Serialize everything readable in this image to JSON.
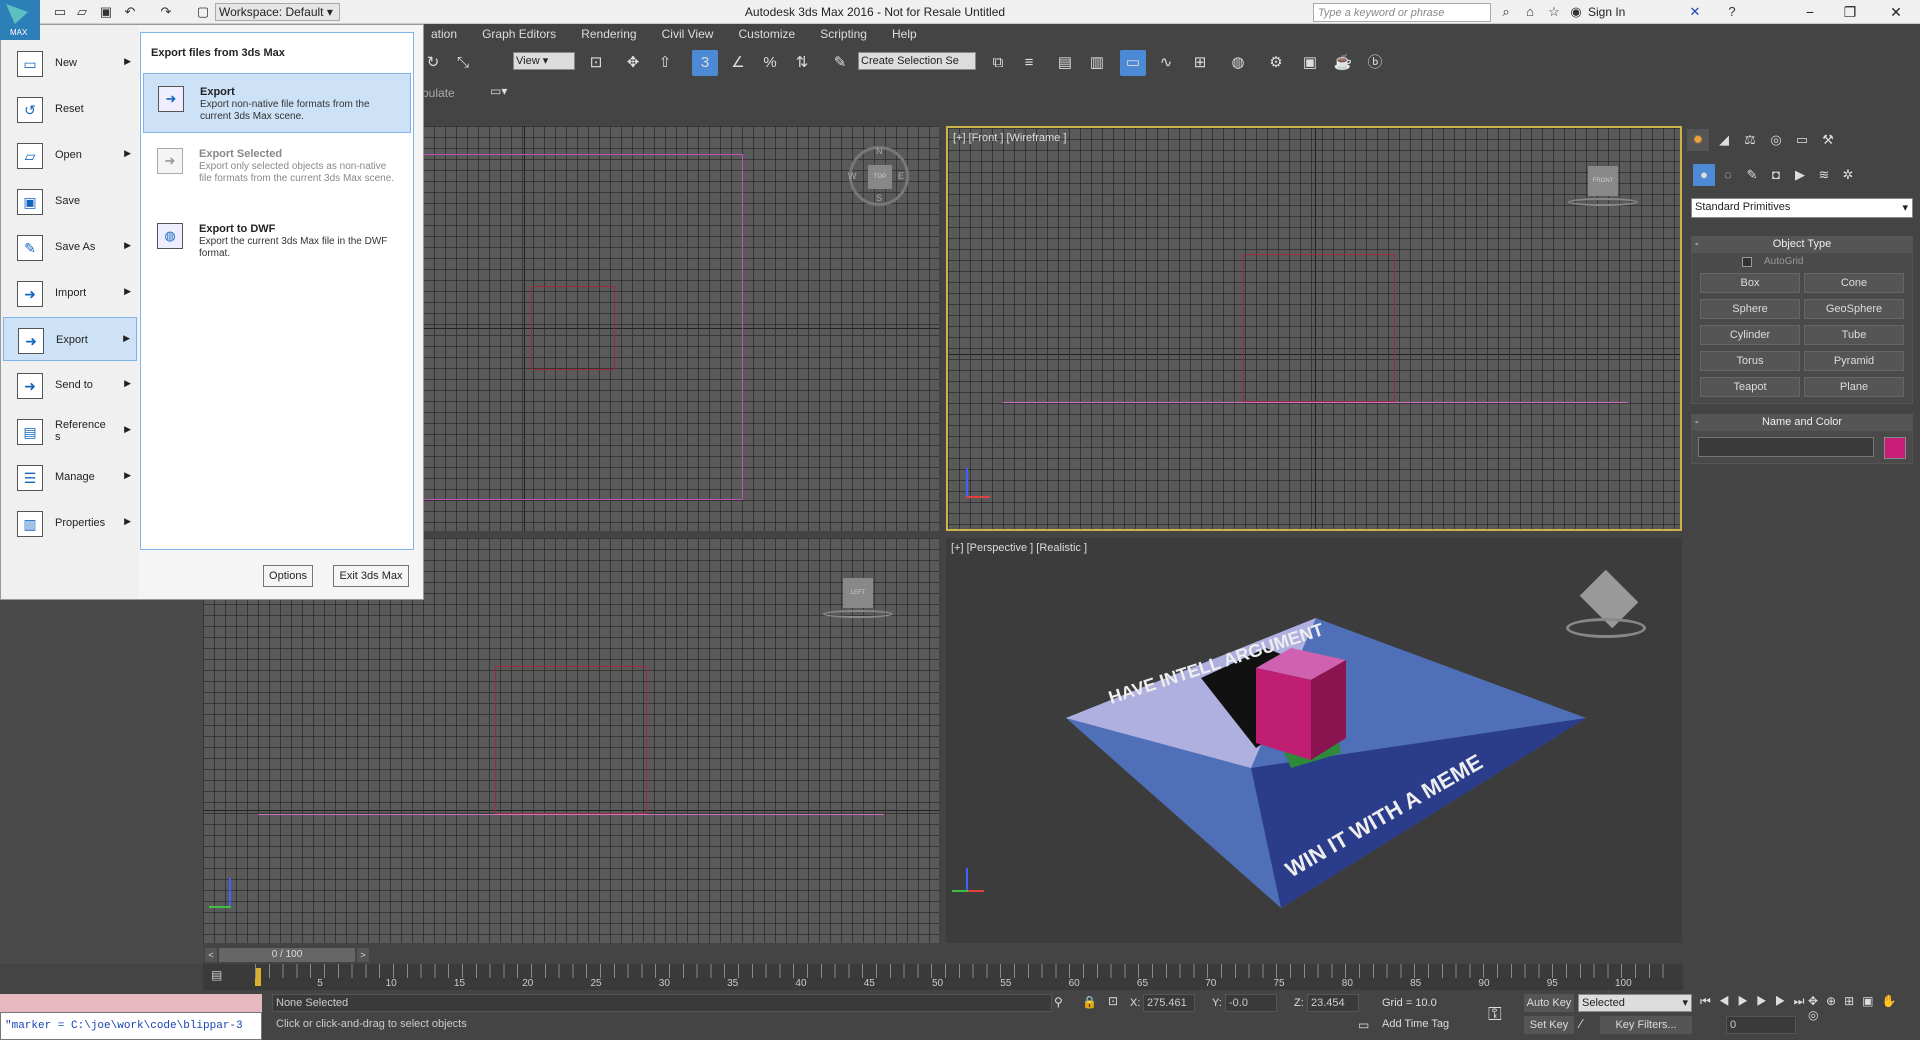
{
  "titlebar": {
    "title": "Autodesk 3ds Max 2016 - Not for Resale    Untitled",
    "workspace": "Workspace: Default",
    "search_placeholder": "Type a keyword or phrase",
    "signin": "Sign In"
  },
  "menubar": {
    "items": [
      "ation",
      "Graph Editors",
      "Rendering",
      "Civil View",
      "Customize",
      "Scripting",
      "Help"
    ]
  },
  "toolbar": {
    "view_dropdown": "View",
    "selection_set": "Create Selection Se",
    "snap_number": "3",
    "ribbon_hint": "pulate"
  },
  "app_menu": {
    "items": [
      {
        "label": "New",
        "icon": "new-icon",
        "arrow": true
      },
      {
        "label": "Reset",
        "icon": "reset-icon",
        "arrow": false
      },
      {
        "label": "Open",
        "icon": "open-icon",
        "arrow": true
      },
      {
        "label": "Save",
        "icon": "save-icon",
        "arrow": false
      },
      {
        "label": "Save As",
        "icon": "save-as-icon",
        "arrow": true
      },
      {
        "label": "Import",
        "icon": "import-icon",
        "arrow": true
      },
      {
        "label": "Export",
        "icon": "export-icon",
        "arrow": true,
        "selected": true
      },
      {
        "label": "Send to",
        "icon": "send-to-icon",
        "arrow": true
      },
      {
        "label": "Reference\ns",
        "icon": "references-icon",
        "arrow": true
      },
      {
        "label": "Manage",
        "icon": "manage-icon",
        "arrow": true
      },
      {
        "label": "Properties",
        "icon": "properties-icon",
        "arrow": true
      }
    ],
    "submenu": {
      "header": "Export files from 3ds Max",
      "items": [
        {
          "title": "Export",
          "desc": "Export non-native file formats from the current 3ds Max scene.",
          "state": "selected"
        },
        {
          "title": "Export Selected",
          "desc": "Export only selected objects as non-native file formats from the current 3ds Max scene.",
          "state": "disabled"
        },
        {
          "title": "Export to DWF",
          "desc": "Export the current 3ds Max file in the DWF format.",
          "state": "normal"
        }
      ]
    },
    "options_label": "Options",
    "exit_label": "Exit 3ds Max",
    "max_label": "MAX"
  },
  "viewports": {
    "front": "[+] [Front ] [Wireframe ]",
    "persp": "[+] [Perspective ] [Realistic ]",
    "viewcube_front": "FRONT",
    "viewcube_top": "TOP",
    "viewcube_left": "LEFT",
    "compass": {
      "n": "N",
      "s": "S",
      "e": "E",
      "w": "W"
    },
    "meme_top": "HAVE INTELL ARGUMENT",
    "meme_bottom": "WIN IT WITH A MEME"
  },
  "command_panel": {
    "category_dropdown": "Standard Primitives",
    "object_type_header": "Object Type",
    "autogrid": "AutoGrid",
    "objects": [
      "Box",
      "Cone",
      "Sphere",
      "GeoSphere",
      "Cylinder",
      "Tube",
      "Torus",
      "Pyramid",
      "Teapot",
      "Plane"
    ],
    "name_color_header": "Name and Color",
    "swatch_color": "#c81e78"
  },
  "timeline": {
    "frame_counter": "0 / 100",
    "ticks": [
      "5",
      "10",
      "15",
      "20",
      "25",
      "30",
      "35",
      "40",
      "45",
      "50",
      "55",
      "60",
      "65",
      "70",
      "75",
      "80",
      "85",
      "90",
      "95",
      "100"
    ]
  },
  "status": {
    "none_selected": "None Selected",
    "prompt": "Click or click-and-drag to select objects",
    "x_label": "X:",
    "x": "275.461",
    "y_label": "Y:",
    "y": "-0.0",
    "z_label": "Z:",
    "z": "23.454",
    "grid": "Grid = 10.0",
    "add_time_tag": "Add Time Tag",
    "auto_key": "Auto Key",
    "set_key": "Set Key",
    "selected": "Selected",
    "key_filters": "Key Filters...",
    "frame": "0",
    "maxscript": "\"marker = C:\\joe\\work\\code\\blippar-3"
  }
}
